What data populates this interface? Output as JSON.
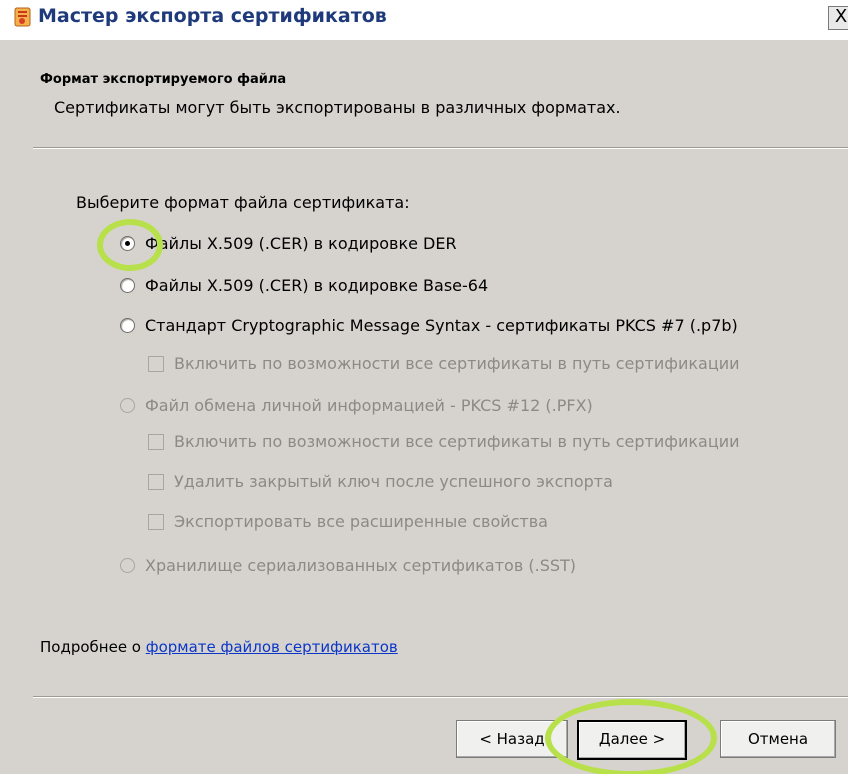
{
  "window": {
    "title": "Мастер экспорта сертификатов",
    "close_glyph": "X"
  },
  "header": {
    "title": "Формат экспортируемого файла",
    "subtitle": "Сертификаты могут быть экспортированы в различных форматах."
  },
  "body": {
    "prompt": "Выберите формат файла сертификата:",
    "options": [
      {
        "label": "Файлы X.509 (.CER) в кодировке DER",
        "selected": true,
        "enabled": true
      },
      {
        "label": "Файлы X.509 (.CER) в кодировке Base-64",
        "selected": false,
        "enabled": true
      },
      {
        "label": "Стандарт Cryptographic Message Syntax - сертификаты PKCS #7 (.p7b)",
        "selected": false,
        "enabled": true
      },
      {
        "label": "Файл обмена личной информацией - PKCS #12 (.PFX)",
        "selected": false,
        "enabled": false
      },
      {
        "label": "Хранилище сериализованных сертификатов (.SST)",
        "selected": false,
        "enabled": false
      }
    ],
    "checkboxes": [
      {
        "label": "Включить по возможности все сертификаты в путь сертификации",
        "checked": false,
        "enabled": false
      },
      {
        "label": "Включить по возможности все сертификаты в путь сертификации",
        "checked": false,
        "enabled": false
      },
      {
        "label": "Удалить закрытый ключ после успешного экспорта",
        "checked": false,
        "enabled": false
      },
      {
        "label": "Экспортировать все расширенные свойства",
        "checked": false,
        "enabled": false
      }
    ]
  },
  "more_info": {
    "prefix": "Подробнее о ",
    "link": "формате файлов сертификатов"
  },
  "buttons": {
    "back": "< Назад",
    "next": "Далее >",
    "cancel": "Отмена"
  },
  "colors": {
    "highlight": "#b8e04a",
    "link": "#0b37c8",
    "title": "#1f3a7a"
  }
}
